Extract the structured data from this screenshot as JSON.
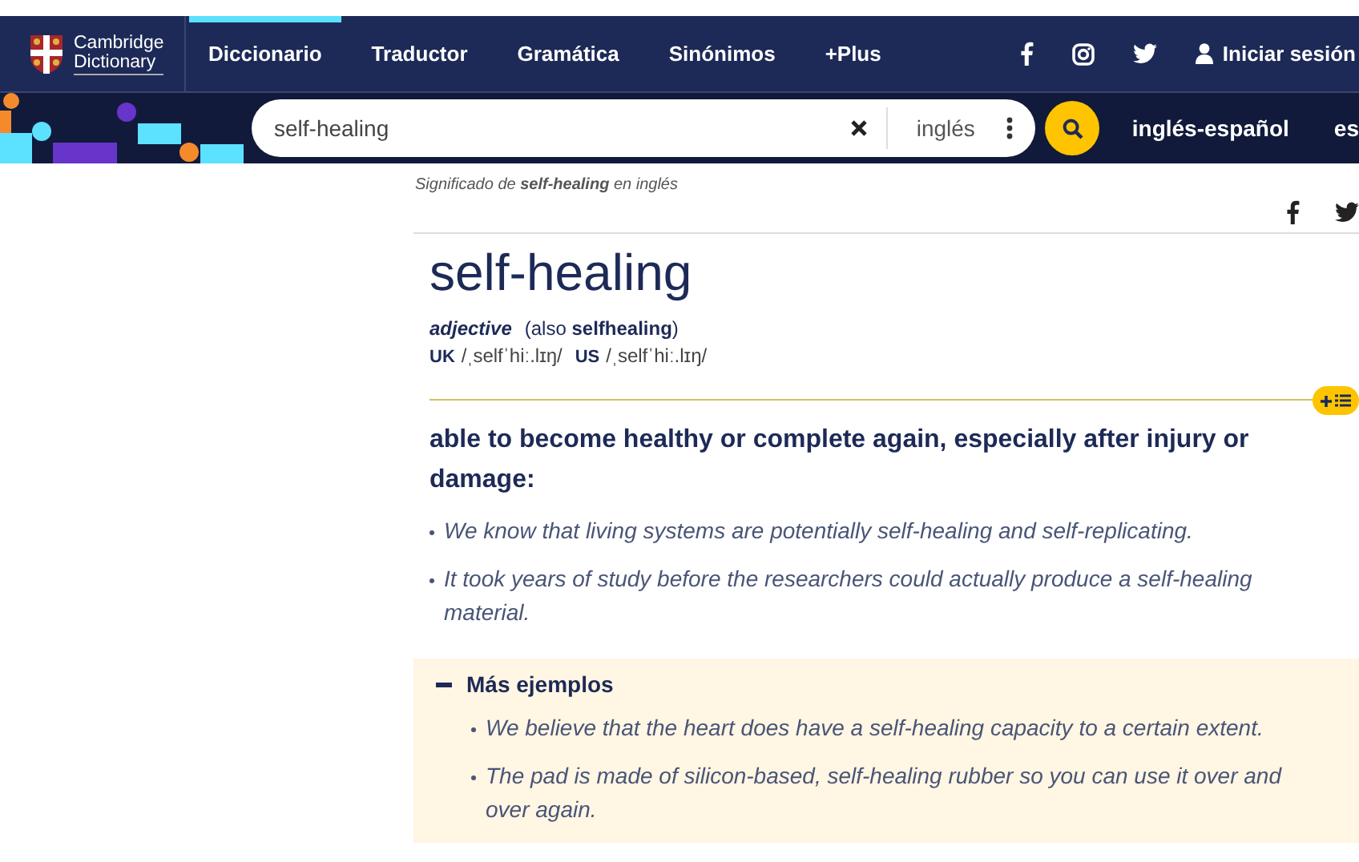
{
  "logo": {
    "line1": "Cambridge",
    "line2": "Dictionary"
  },
  "nav": [
    {
      "label": "Diccionario",
      "selected": true
    },
    {
      "label": "Traductor",
      "selected": false
    },
    {
      "label": "Gramática",
      "selected": false
    },
    {
      "label": "Sinónimos",
      "selected": false
    },
    {
      "label": "+Plus",
      "selected": false
    }
  ],
  "login": "Iniciar sesión",
  "search": {
    "value": "self-healing",
    "language": "inglés"
  },
  "dictionaries": [
    "inglés-español",
    "es"
  ],
  "breadcrumb": "Significado de **self-healing** en inglés",
  "headword": "self-healing",
  "pos": "adjective",
  "variant": "(also **selfhealing**)",
  "pronunciations": [
    {
      "region": "UK",
      "ipa": "/ˌselfˈhiː.lɪŋ/"
    },
    {
      "region": "US",
      "ipa": "/ˌselfˈhiː.lɪŋ/"
    }
  ],
  "definition": "able to become healthy or complete again, especially after injury or damage:",
  "examples": [
    "We know that living systems are potentially self-healing and self-replicating.",
    "It took years of study before the researchers could actually produce a self-healing material."
  ],
  "more_examples": {
    "title": "Más ejemplos",
    "expanded": true,
    "items": [
      "We believe that the heart does have a self-healing capacity to a certain extent.",
      "The pad is made of silicon-based, self-healing rubber so you can use it over and over again."
    ]
  }
}
